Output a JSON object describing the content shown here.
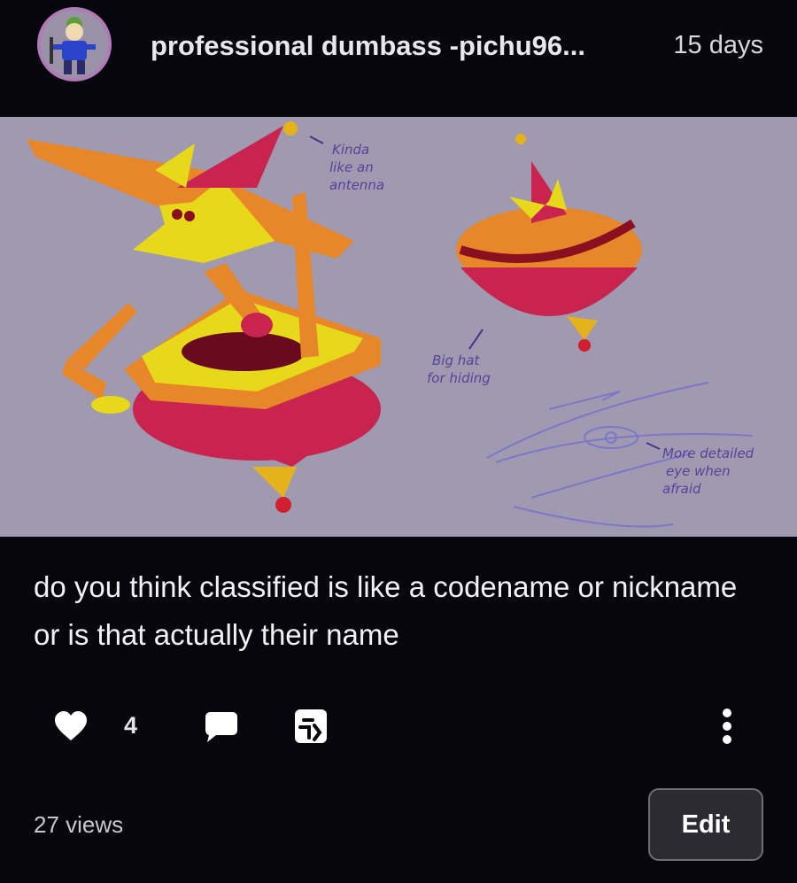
{
  "post": {
    "username": "professional dumbass -pichu96...",
    "timestamp": "15 days",
    "avatar_icon": "avatar-image",
    "caption": "do you think classified is like a codename or nickname or is that actually their name",
    "likes": "4",
    "views": "27 views",
    "edit_label": "Edit"
  },
  "artwork": {
    "annotations": {
      "antenna": [
        "Kinda",
        "like an",
        "antenna"
      ],
      "hat": [
        "Big hat",
        "for hiding"
      ],
      "eye": [
        "More detailed",
        "eye when",
        "afraid"
      ]
    }
  },
  "icons": {
    "like": "heart-icon",
    "comment": "speech-bubble-icon",
    "share": "share-icon",
    "more": "vertical-ellipsis-icon"
  },
  "colors": {
    "background": "#07060c",
    "artwork_bg": "#9f9aaf",
    "avatar_ring": "#b07ab8",
    "edit_button_bg": "#2c2b33"
  }
}
